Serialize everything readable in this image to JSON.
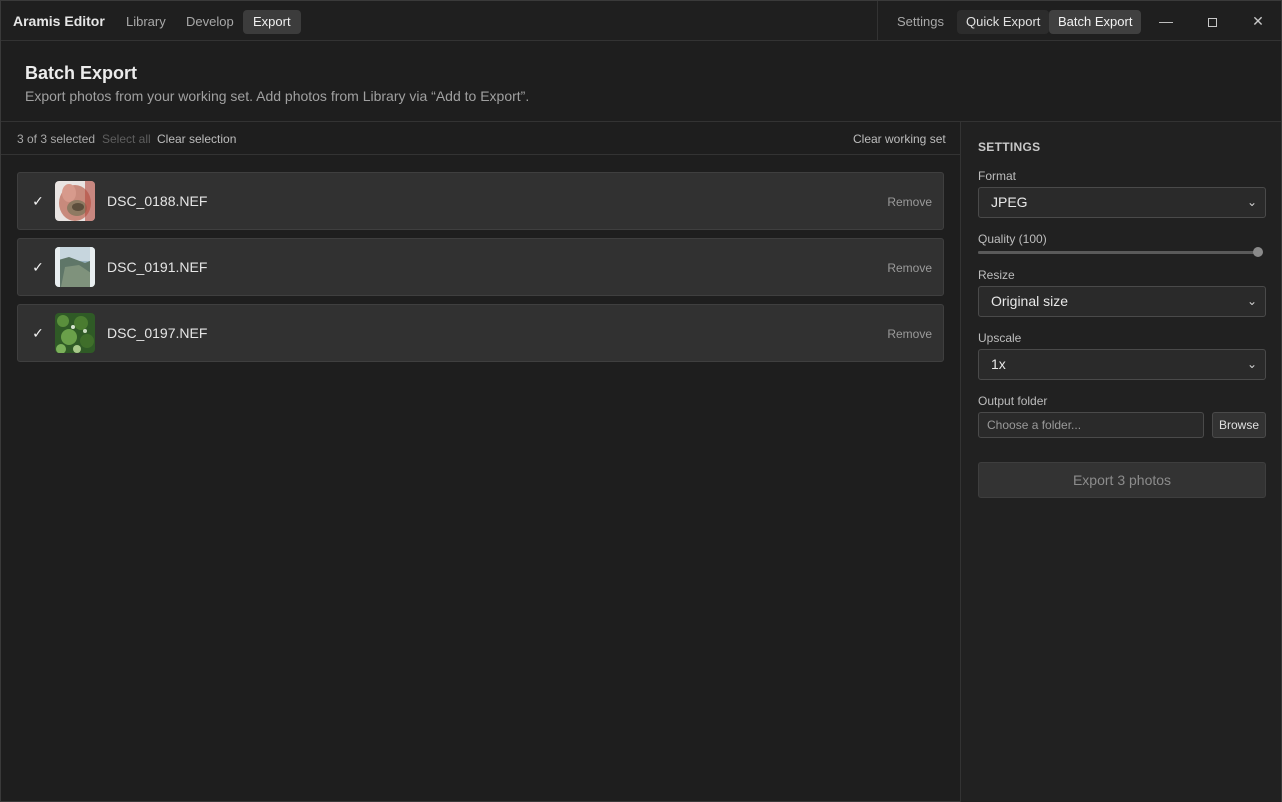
{
  "app": {
    "title": "Aramis Editor"
  },
  "nav": {
    "tabs": [
      {
        "label": "Library"
      },
      {
        "label": "Develop"
      },
      {
        "label": "Export",
        "active": true
      }
    ]
  },
  "right_tabs": {
    "settings": "Settings",
    "quick_export": "Quick Export",
    "batch_export": "Batch Export",
    "active": "Batch Export"
  },
  "window_controls": {
    "minimize": "—",
    "close": "✕"
  },
  "header": {
    "title": "Batch Export",
    "subtitle": "Export photos from your working set. Add photos from Library via “Add to Export”."
  },
  "selection": {
    "count_text": "3 of 3 selected",
    "select_all": "Select all",
    "clear_selection": "Clear selection",
    "clear_working_set": "Clear working set"
  },
  "files": [
    {
      "name": "DSC_0188.NEF",
      "checked": true,
      "remove": "Remove",
      "thumb": "hand-icon"
    },
    {
      "name": "DSC_0191.NEF",
      "checked": true,
      "remove": "Remove",
      "thumb": "landscape-icon"
    },
    {
      "name": "DSC_0197.NEF",
      "checked": true,
      "remove": "Remove",
      "thumb": "foliage-icon"
    }
  ],
  "settings": {
    "section_title": "SETTINGS",
    "format_label": "Format",
    "format_value": "JPEG",
    "quality_label": "Quality (100)",
    "quality_value": 100,
    "resize_label": "Resize",
    "resize_value": "Original size",
    "upscale_label": "Upscale",
    "upscale_value": "1x",
    "output_label": "Output folder",
    "output_placeholder": "Choose a folder...",
    "browse_label": "Browse",
    "export_label": "Export 3 photos"
  },
  "colors": {
    "background": "#1e1e1e",
    "panel": "#212121",
    "row": "#313131",
    "active_tab": "#404040"
  }
}
